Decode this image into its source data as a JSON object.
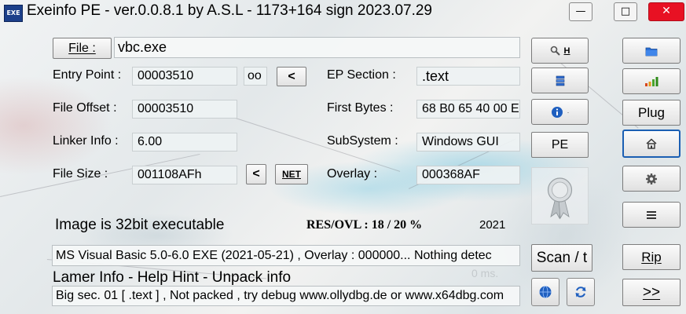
{
  "window": {
    "title": "Exeinfo PE - ver.0.0.8.1  by A.S.L -  1173+164 sign  2023.07.29",
    "app_icon_text": "EXE",
    "minimize": "—",
    "maximize": "□",
    "close": "✕"
  },
  "file": {
    "button_label": "File :",
    "value": "vbc.exe"
  },
  "fields": {
    "entry_point_label": "Entry Point :",
    "entry_point_value": "00003510",
    "oo_label": "oo",
    "entry_point_prev": "<",
    "ep_section_label": "EP Section :",
    "ep_section_value": ".text",
    "file_offset_label": "File Offset :",
    "file_offset_value": "00003510",
    "first_bytes_label": "First Bytes :",
    "first_bytes_value": "68 B0 65 40 00 E",
    "linker_info_label": "Linker Info :",
    "linker_info_value": "6.00",
    "subsystem_label": "SubSystem :",
    "subsystem_value": "Windows GUI",
    "file_size_label": "File Size :",
    "file_size_value": "001108AFh",
    "file_size_prev": "<",
    "net_label": "NET",
    "overlay_label": "Overlay :",
    "overlay_value": "000368AF"
  },
  "status": {
    "image_info": "Image is 32bit executable",
    "res_ovl": "RES/OVL : 18 / 20 %",
    "year": "2021",
    "detection": "MS Visual Basic 5.0-6.0   EXE  (2021-05-21) , Overlay : 000000... Nothing detec",
    "lamer_info": "Lamer Info - Help Hint - Unpack info",
    "time": "0 ms.",
    "hint": "Big sec. 01 [ .text ] , Not packed , try debug www.ollydbg.de or www.x64dbg.com"
  },
  "middle_buttons": {
    "search_h_label": "H",
    "pe_label": "PE",
    "scan_label": "Scan / t"
  },
  "right_buttons": {
    "plug_label": "Plug",
    "rip_label": "Rip",
    "next_label": ">>"
  },
  "colors": {
    "close_button": "#e81123",
    "info_icon": "#1f5fbf",
    "folder_icon": "#2a6fd6"
  }
}
